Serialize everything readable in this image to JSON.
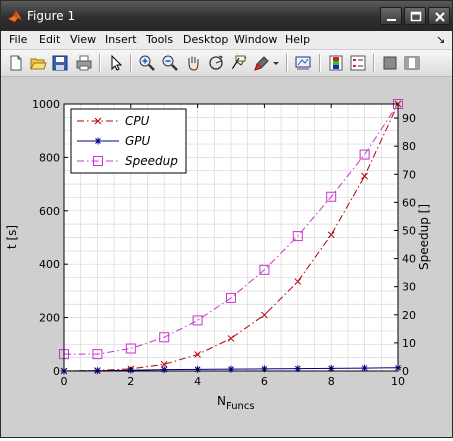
{
  "window": {
    "title": "Figure 1",
    "controls": [
      "minimize",
      "maximize",
      "close"
    ]
  },
  "menu": {
    "items": [
      "File",
      "Edit",
      "View",
      "Insert",
      "Tools",
      "Desktop",
      "Window",
      "Help"
    ],
    "dock_arrow": "↘"
  },
  "toolbar": {
    "icons": [
      "new-figure-icon",
      "open-file-icon",
      "save-icon",
      "print-icon",
      "pointer-icon",
      "zoom-in-icon",
      "zoom-out-icon",
      "pan-icon",
      "rotate-3d-icon",
      "data-cursor-icon",
      "brush-icon",
      "brush-dropdown-icon",
      "link-plot-icon",
      "colorbar-icon",
      "legend-icon",
      "hide-plot-tools-icon",
      "show-plot-tools-icon"
    ]
  },
  "colors": {
    "cpu": "#b30000",
    "gpu": "#00008b",
    "speedup": "#cc33cc",
    "grid": "#d8d8d8"
  },
  "chart_data": {
    "type": "line",
    "xlabel_base": "N",
    "xlabel_sub": "Funcs",
    "ylabel_left": "t [s]",
    "ylabel_right": "Speedup []",
    "xlim": [
      0,
      10
    ],
    "ylim_left": [
      0,
      1000
    ],
    "ylim_right": [
      0,
      95
    ],
    "x_ticks": [
      "0",
      "2",
      "4",
      "6",
      "8",
      "10"
    ],
    "y_ticks_left": [
      "0",
      "200",
      "400",
      "600",
      "800",
      "1000"
    ],
    "y_ticks_right": [
      "0",
      "10",
      "20",
      "30",
      "40",
      "50",
      "60",
      "70",
      "80",
      "90"
    ],
    "grid": true,
    "legend_position": "top-left",
    "series": [
      {
        "name": "CPU",
        "axis": "left",
        "marker": "x",
        "linestyle": "dashdot",
        "x": [
          0,
          1,
          2,
          3,
          4,
          5,
          6,
          7,
          8,
          9,
          10
        ],
        "values": [
          0,
          2,
          8,
          25,
          62,
          122,
          210,
          335,
          510,
          730,
          1000
        ]
      },
      {
        "name": "GPU",
        "axis": "left",
        "marker": "star",
        "linestyle": "solid",
        "x": [
          0,
          1,
          2,
          3,
          4,
          5,
          6,
          7,
          8,
          9,
          10
        ],
        "values": [
          0,
          1,
          3,
          5,
          6,
          7,
          8,
          9,
          10,
          11,
          12
        ]
      },
      {
        "name": "Speedup",
        "axis": "right",
        "marker": "square",
        "linestyle": "dashdot",
        "x": [
          0,
          1,
          2,
          3,
          4,
          5,
          6,
          7,
          8,
          9,
          10
        ],
        "values": [
          6,
          6,
          8,
          12,
          18,
          26,
          36,
          48,
          62,
          77,
          95
        ]
      }
    ]
  }
}
